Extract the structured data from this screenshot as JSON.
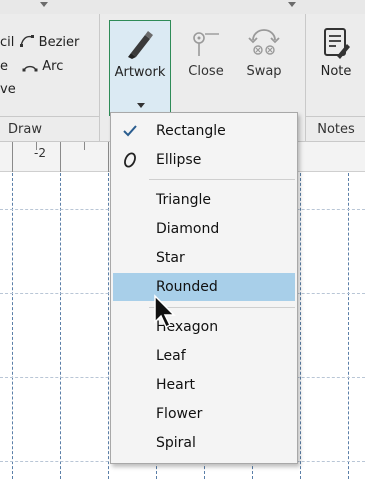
{
  "ribbon": {
    "draw_group": {
      "label": "Draw",
      "items": [
        "cil",
        "Bezier",
        "e",
        "Arc",
        "ve"
      ]
    },
    "artwork_group": {
      "artwork_label": "Artwork",
      "close_label": "Close",
      "swap_label": "Swap"
    },
    "notes_group": {
      "label": "Notes",
      "note_label": "Note"
    }
  },
  "ruler": {
    "label": "-2"
  },
  "menu": {
    "items": [
      {
        "label": "Rectangle",
        "icon": "check-icon",
        "checked": true
      },
      {
        "label": "Ellipse",
        "icon": "ellipse-icon"
      },
      {
        "label": "Triangle"
      },
      {
        "label": "Diamond"
      },
      {
        "label": "Star"
      },
      {
        "label": "Rounded",
        "highlighted": true
      },
      {
        "label": "Hexagon"
      },
      {
        "label": "Leaf"
      },
      {
        "label": "Heart"
      },
      {
        "label": "Flower"
      },
      {
        "label": "Spiral"
      }
    ]
  },
  "colors": {
    "highlight": "#a8cfe9",
    "artwork_border": "#2e8b57",
    "grid_line": "#5b7fa8"
  }
}
